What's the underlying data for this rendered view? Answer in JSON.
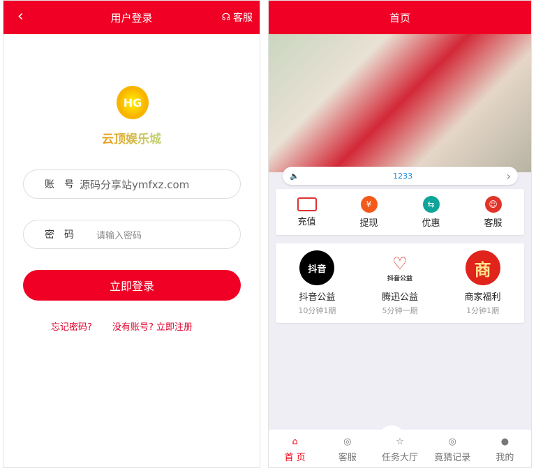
{
  "login": {
    "title": "用户登录",
    "service": "客服",
    "brand": "云顶娱乐城",
    "account_label": "账号",
    "account_value": "源码分享站ymfxz.com",
    "password_label": "密码",
    "password_placeholder": "请输入密码",
    "login_button": "立即登录",
    "forgot": "忘记密码?",
    "register": "没有账号? 立即注册"
  },
  "home": {
    "title": "首页",
    "notice": "1233",
    "quick": [
      {
        "label": "充值",
        "icon": "card-icon"
      },
      {
        "label": "提现",
        "icon": "coin-icon"
      },
      {
        "label": "优惠",
        "icon": "exchange-icon"
      },
      {
        "label": "客服",
        "icon": "agent-icon"
      }
    ],
    "games": [
      {
        "name": "抖音公益",
        "sub": "10分钟1期",
        "logo": "抖音"
      },
      {
        "name": "腾迅公益",
        "sub": "5分钟一期",
        "logo": "抖音公益"
      },
      {
        "name": "商家福利",
        "sub": "1分钟1期",
        "logo": "商"
      }
    ],
    "tabs": [
      {
        "label": "首 页"
      },
      {
        "label": "客服"
      },
      {
        "label": "任务大厅"
      },
      {
        "label": "竟猜记录"
      },
      {
        "label": "我的"
      }
    ]
  },
  "colors": {
    "primary": "#ef0024",
    "notice": "#1a8fd8"
  }
}
